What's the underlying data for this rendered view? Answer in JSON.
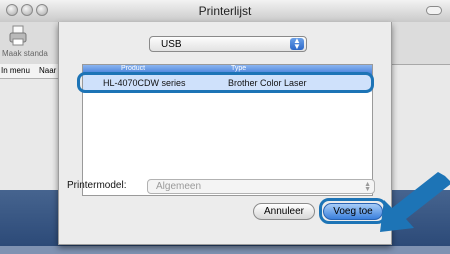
{
  "window": {
    "title": "Printerlijst"
  },
  "toolbar": {
    "make_default_label": "Maak standa"
  },
  "list_header": {
    "col1": "In menu",
    "col2": "Naar"
  },
  "sheet": {
    "connection_popup": {
      "value": "USB"
    },
    "table": {
      "headers": [
        "Product",
        "Type"
      ],
      "rows": [
        {
          "product": "HL-4070CDW series",
          "type": "Brother Color Laser"
        }
      ]
    },
    "printer_model": {
      "label": "Printermodel:",
      "value": "Algemeen"
    },
    "buttons": {
      "cancel": "Annuleer",
      "add": "Voeg toe"
    }
  },
  "colors": {
    "highlight_ring": "#1d74b6",
    "selection": "#cfe1fb"
  },
  "icons": {
    "printer": "printer-icon",
    "arrow": "pointer-arrow-icon"
  }
}
